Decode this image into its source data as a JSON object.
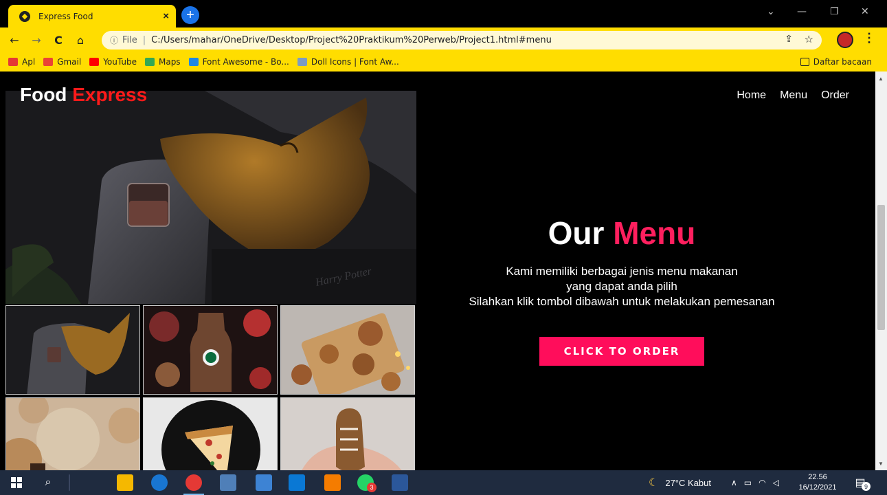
{
  "browser": {
    "tab_title": "Express Food",
    "tab_close": "×",
    "new_tab": "+",
    "window_controls": {
      "minimize": "—",
      "restore": "❐",
      "close": "✕",
      "tab_search": "⌄"
    },
    "nav": {
      "back": "←",
      "forward": "→",
      "reload": "C",
      "home": "⌂"
    },
    "omnibox": {
      "info": "ⓘ",
      "scheme": "File",
      "url": "C:/Users/mahar/OneDrive/Desktop/Project%20Praktikum%20Perweb/Project1.html#menu"
    },
    "bookmarks": [
      {
        "label": "Apl",
        "color": "#e53935"
      },
      {
        "label": "Gmail",
        "color": "#ea4335"
      },
      {
        "label": "YouTube",
        "color": "#ff0000"
      },
      {
        "label": "Maps",
        "color": "#34a853"
      },
      {
        "label": "Font Awesome - Bo...",
        "color": "#1e88e5"
      },
      {
        "label": "Doll Icons | Font Aw...",
        "color": "#7b9cc4"
      }
    ],
    "reading_list": "Daftar bacaan"
  },
  "site": {
    "logo_main": "Food",
    "logo_accent": "Express",
    "nav_links": [
      "Home",
      "Menu",
      "Order"
    ],
    "heading_main": "Our",
    "heading_accent": "Menu",
    "description": [
      "Kami memiliki berbagai jenis menu makanan",
      "yang dapat anda pilih",
      "Silahkan klik tombol dibawah untuk melakukan pemesanan"
    ],
    "cta_label": "CLICK TO ORDER",
    "accent_color": "#ff0d5b"
  },
  "taskbar": {
    "weather": "27°C Kabut",
    "time": "22.56",
    "date": "16/12/2021",
    "notification_count": "9",
    "whatsapp_badge": "3"
  }
}
